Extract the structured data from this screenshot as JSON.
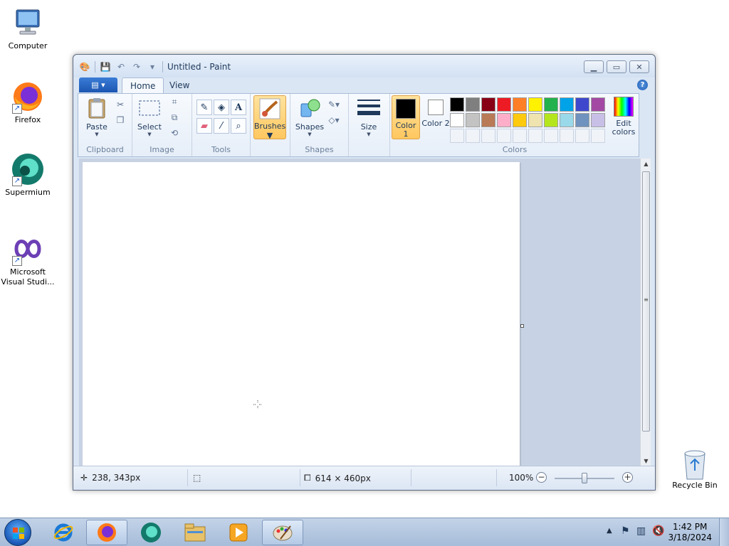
{
  "desktop": {
    "icons": [
      {
        "label": "Computer",
        "icon": "computer-icon"
      },
      {
        "label": "Firefox",
        "icon": "firefox-icon"
      },
      {
        "label": "Supermium",
        "icon": "supermium-icon"
      },
      {
        "label": "Microsoft Visual Studi...",
        "icon": "visual-studio-icon"
      }
    ],
    "recycle_bin": "Recycle Bin"
  },
  "window": {
    "title": "Untitled - Paint",
    "tabs": [
      {
        "label": "Home",
        "active": true
      },
      {
        "label": "View",
        "active": false
      }
    ],
    "ribbon": {
      "clipboard": {
        "label": "Clipboard",
        "paste": "Paste"
      },
      "image": {
        "label": "Image",
        "select": "Select"
      },
      "tools": {
        "label": "Tools"
      },
      "brushes": {
        "label": "Brushes"
      },
      "shapes": {
        "label": "Shapes",
        "button": "Shapes"
      },
      "size": {
        "label": "Size"
      },
      "colors": {
        "label": "Colors",
        "color1_label": "Color 1",
        "color2_label": "Color 2",
        "color1": "#000000",
        "color2": "#ffffff",
        "edit_colors": "Edit colors",
        "palette_row1": [
          "#000000",
          "#7f7f7f",
          "#880015",
          "#ed1c24",
          "#ff7f27",
          "#fff200",
          "#22b14c",
          "#00a2e8",
          "#3f48cc",
          "#a349a4"
        ],
        "palette_row2": [
          "#ffffff",
          "#c3c3c3",
          "#b97a57",
          "#ffaec9",
          "#ffc90e",
          "#efe4b0",
          "#b5e61d",
          "#99d9ea",
          "#7092be",
          "#c8bfe7"
        ]
      }
    },
    "status": {
      "cursor_pos": "238, 343px",
      "canvas_size": "614 × 460px",
      "zoom": "100%"
    }
  },
  "taskbar": {
    "time": "1:42 PM",
    "date": "3/18/2024",
    "items": [
      "internet-explorer-icon",
      "firefox-icon",
      "supermium-icon",
      "file-explorer-icon",
      "media-player-icon",
      "paint-icon"
    ]
  }
}
